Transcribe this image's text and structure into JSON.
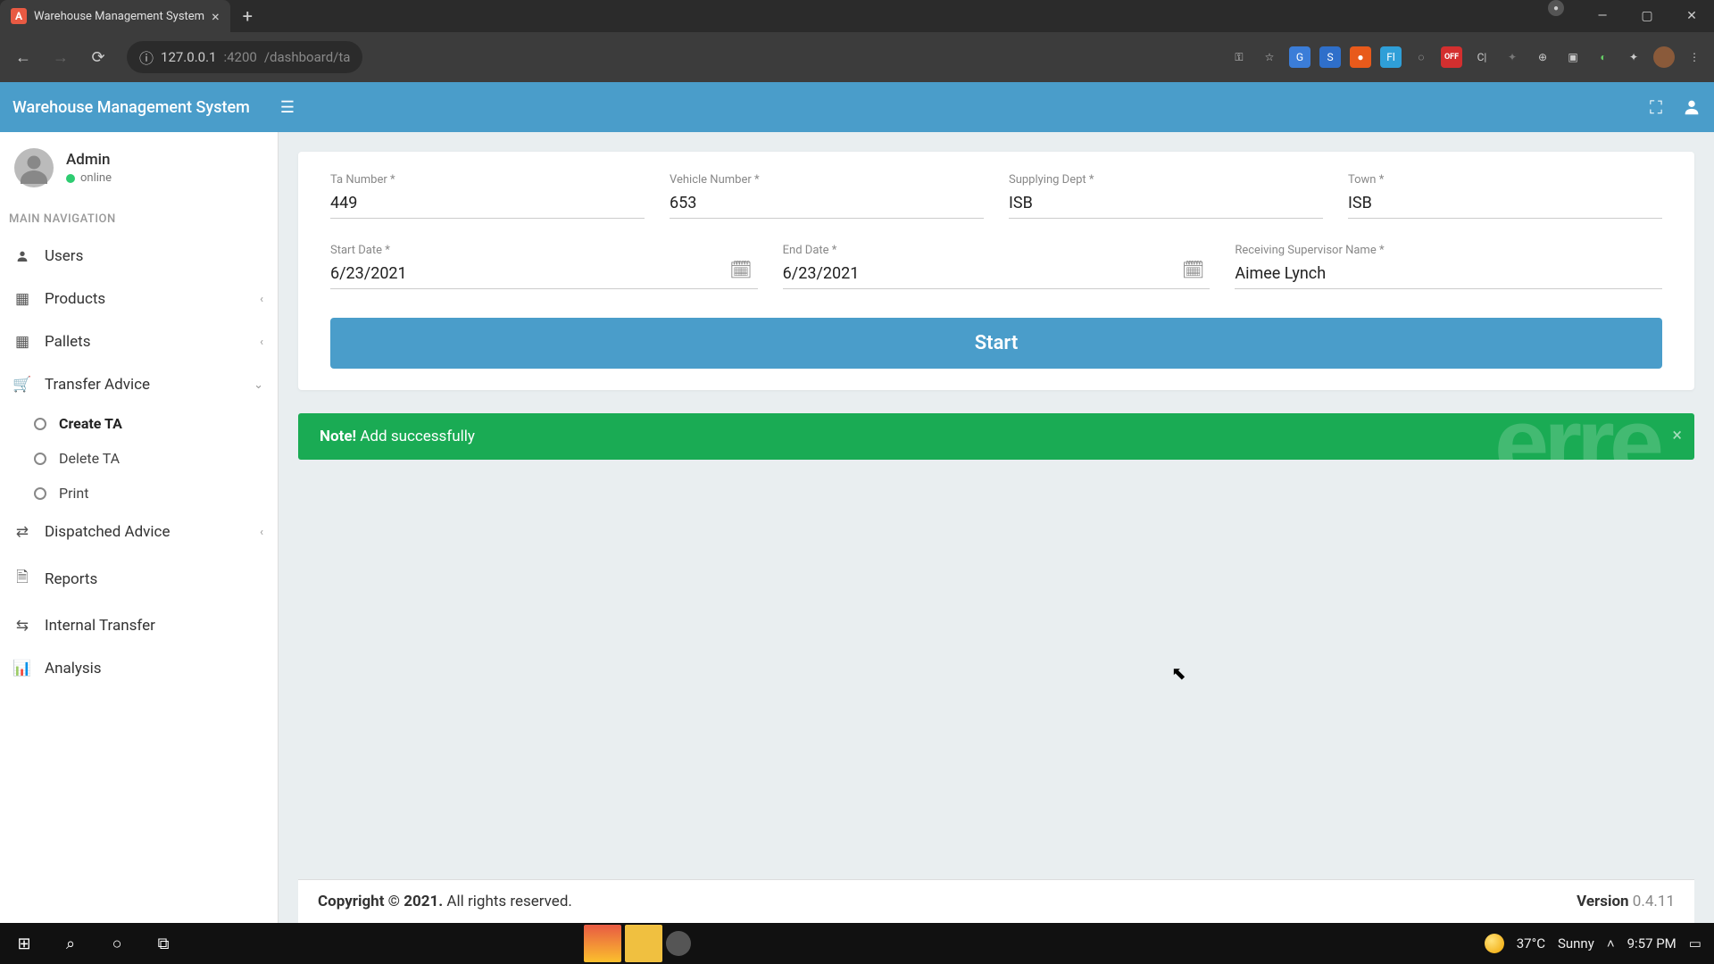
{
  "browser": {
    "tab_title": "Warehouse Management System",
    "tab_favicon_letter": "A",
    "url_host": "127.0.0.1",
    "url_port": ":4200",
    "url_path": "/dashboard/ta"
  },
  "header": {
    "title": "Warehouse Management System"
  },
  "sidebar": {
    "user": {
      "name": "Admin",
      "status": "online"
    },
    "heading": "MAIN NAVIGATION",
    "items": {
      "users": "Users",
      "products": "Products",
      "pallets": "Pallets",
      "transfer_advice": "Transfer Advice",
      "dispatched_advice": "Dispatched Advice",
      "reports": "Reports",
      "internal_transfer": "Internal Transfer",
      "analysis": "Analysis"
    },
    "transfer_sub": {
      "create": "Create TA",
      "delete": "Delete TA",
      "print": "Print"
    }
  },
  "form": {
    "ta_number": {
      "label": "Ta Number *",
      "value": "449"
    },
    "vehicle_number": {
      "label": "Vehicle Number *",
      "value": "653"
    },
    "supplying_dept": {
      "label": "Supplying Dept *",
      "value": "ISB"
    },
    "town": {
      "label": "Town *",
      "value": "ISB"
    },
    "start_date": {
      "label": "Start Date *",
      "value": "6/23/2021"
    },
    "end_date": {
      "label": "End Date *",
      "value": "6/23/2021"
    },
    "supervisor": {
      "label": "Receiving Supervisor Name *",
      "value": "Aimee Lynch"
    },
    "start_button": "Start"
  },
  "alert": {
    "prefix": "Note!",
    "message": " Add successfully"
  },
  "footer": {
    "copyright_bold": "Copyright © 2021.",
    "copyright_rest": " All rights reserved.",
    "version_label": "Version",
    "version_value": " 0.4.11"
  },
  "taskbar": {
    "weather_temp": "37°C",
    "weather_desc": "Sunny",
    "time": "9:57 PM"
  },
  "ext_badge": "OFF"
}
